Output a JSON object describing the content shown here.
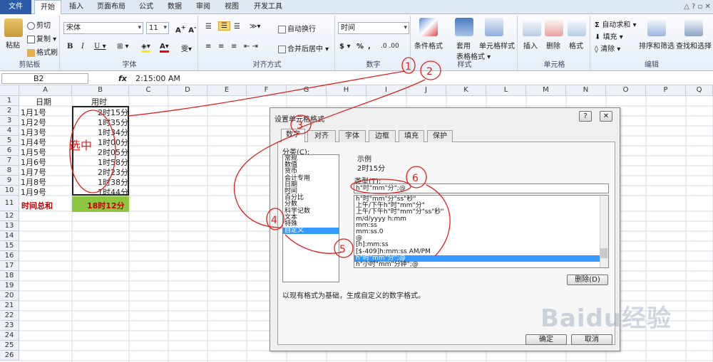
{
  "tabs": {
    "file": "文件",
    "home": "开始",
    "insert": "插入",
    "layout": "页面布局",
    "formulas": "公式",
    "data": "数据",
    "review": "审阅",
    "view": "视图",
    "developer": "开发工具"
  },
  "ribbon": {
    "paste": "粘贴",
    "cut": "剪切",
    "copy": "复制 ▾",
    "format_painter": "格式刷",
    "clipboard": "剪贴板",
    "font_name": "宋体",
    "font_size": "11",
    "font": "字体",
    "wrap": "自动换行",
    "merge": "合并后居中 ▾",
    "alignment": "对齐方式",
    "num_format": "时间",
    "number": "数字",
    "cond_format": "条件格式",
    "format_table1": "套用",
    "format_table2": "表格格式 ▾",
    "cell_styles": "单元格样式",
    "styles": "样式",
    "insert": "插入",
    "delete": "删除",
    "format": "格式",
    "cells": "单元格",
    "autosum": "自动求和 ▾",
    "fill": "填充 ▾",
    "clear": "清除 ▾",
    "sort": "排序和筛选",
    "find": "查找和选择",
    "editing": "编辑"
  },
  "formula_bar": {
    "name": "B2",
    "fx": "fx",
    "value": "2:15:00 AM"
  },
  "columns": [
    "A",
    "B",
    "C",
    "D",
    "E",
    "F",
    "G",
    "H",
    "I",
    "J",
    "K",
    "L",
    "M",
    "N",
    "O",
    "P",
    "Q"
  ],
  "rows": [
    "1",
    "2",
    "3",
    "4",
    "5",
    "6",
    "7",
    "8",
    "9",
    "10",
    "11",
    "12",
    "13",
    "14",
    "15",
    "16",
    "17",
    "18",
    "19",
    "20",
    "21",
    "22",
    "23",
    "24",
    "25",
    "26"
  ],
  "sheet": {
    "a1": "日期",
    "b1": "用时",
    "dates": [
      "1月1号",
      "1月2号",
      "1月3号",
      "1月4号",
      "1月5号",
      "1月6号",
      "1月7号",
      "1月8号",
      "1月9号"
    ],
    "times": [
      "2时15分",
      "1时35分",
      "1时34分",
      "1时00分",
      "2时05分",
      "1时58分",
      "2时23分",
      "1时38分",
      "1时44分"
    ],
    "total_label": "时间总和",
    "total_value": "18时12分"
  },
  "dialog": {
    "title": "设置单元格格式",
    "tabs": [
      "数字",
      "对齐",
      "字体",
      "边框",
      "填充",
      "保护"
    ],
    "category_label": "分类(C):",
    "categories": [
      "常规",
      "数值",
      "货币",
      "会计专用",
      "日期",
      "时间",
      "百分比",
      "分数",
      "科学记数",
      "文本",
      "特殊",
      "自定义"
    ],
    "sample_label": "示例",
    "sample": "2时15分",
    "type_label": "类型(T):",
    "type_value": "h\"时\"mm\"分\";@",
    "type_list": [
      "h\"时\"mm\"分\"ss\"秒\"",
      "上午/下午h\"时\"mm\"分\"",
      "上午/下午h\"时\"mm\"分\"ss\"秒\"",
      "m/d/yyyy h:mm",
      "mm:ss",
      "mm:ss.0",
      "@",
      "[h]:mm:ss",
      "[$-409]h:mm:ss AM/PM",
      "h\"时\"mm\"分\";@",
      "h\"小时\"mm\"分钟\";@"
    ],
    "delete": "删除(D)",
    "description": "以现有格式为基础，生成自定义的数字格式。",
    "ok": "确定",
    "cancel": "取消"
  },
  "annotations": [
    "选中",
    "1",
    "2",
    "3",
    "4",
    "5",
    "6"
  ],
  "watermark": "Baidu经验"
}
